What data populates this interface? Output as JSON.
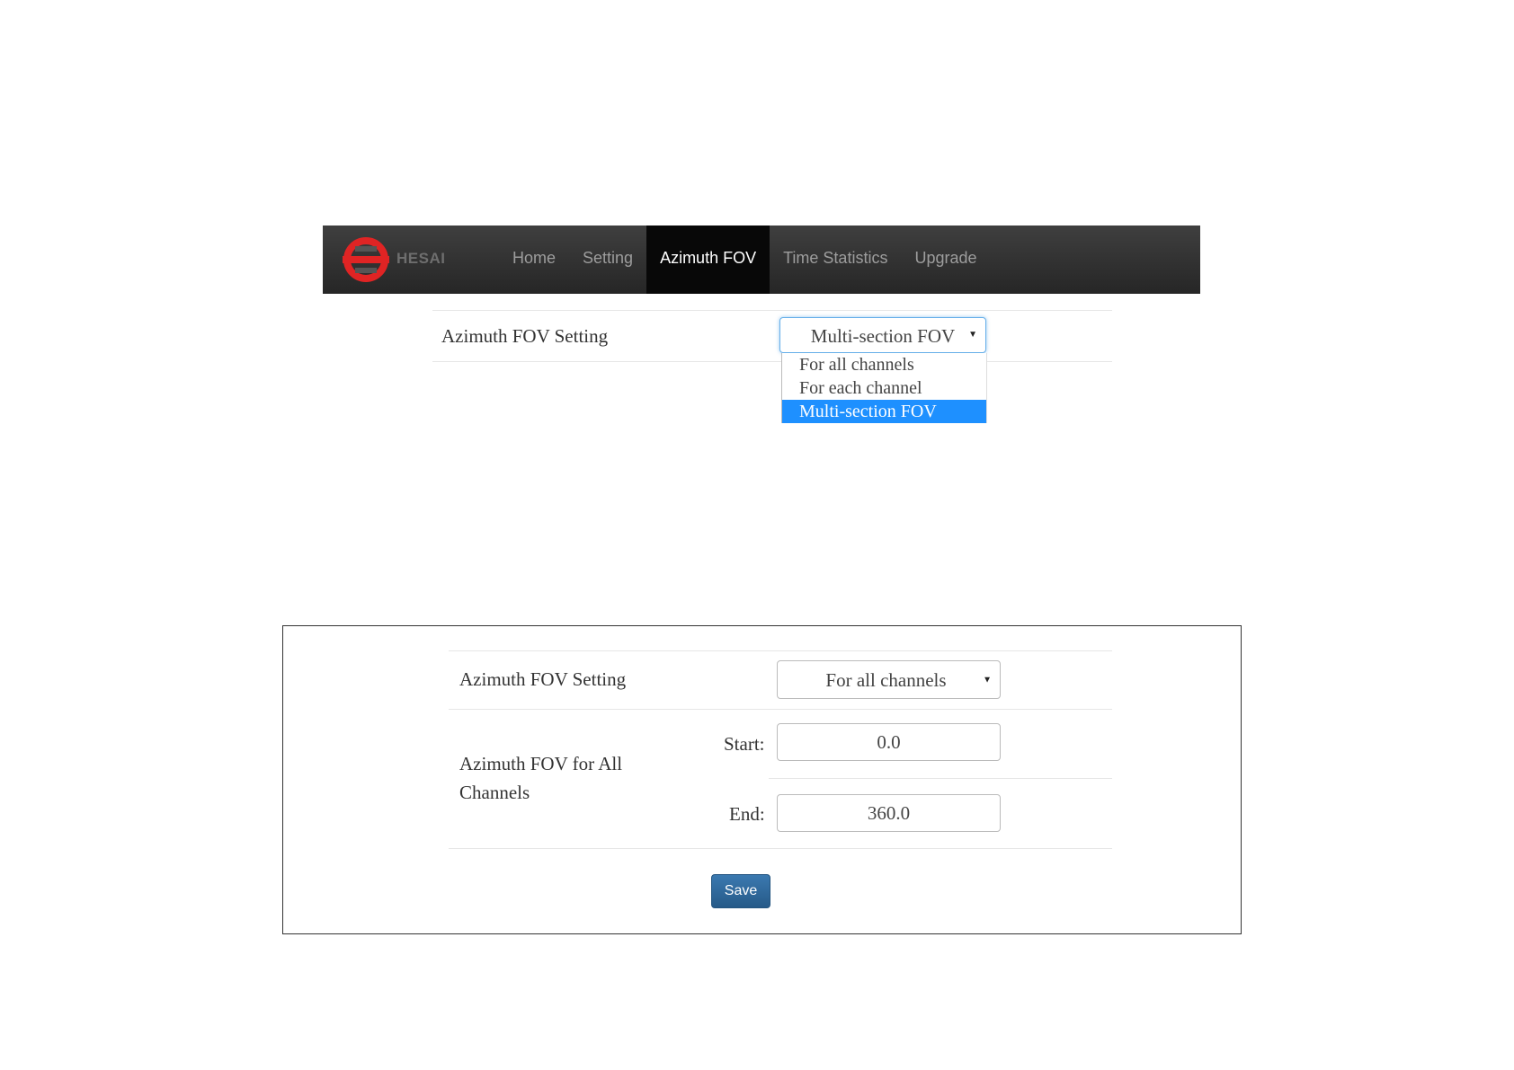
{
  "brand": {
    "name": "HESAI",
    "logo_color": "#e02424"
  },
  "navbar": {
    "items": [
      {
        "label": "Home"
      },
      {
        "label": "Setting"
      },
      {
        "label": "Azimuth FOV",
        "active": true
      },
      {
        "label": "Time Statistics"
      },
      {
        "label": "Upgrade"
      }
    ]
  },
  "top_form": {
    "setting_label": "Azimuth FOV Setting",
    "select_value": "Multi-section FOV",
    "dropdown_options": [
      "For all channels",
      "For each channel",
      "Multi-section FOV"
    ],
    "selected_option": "Multi-section FOV"
  },
  "bottom_form": {
    "setting_label": "Azimuth FOV Setting",
    "select_value": "For all channels",
    "fov_label": "Azimuth FOV for All Channels",
    "start_label": "Start:",
    "start_value": "0.0",
    "end_label": "End:",
    "end_value": "360.0",
    "save_label": "Save"
  },
  "colors": {
    "accent": "#1e90ff",
    "button": "#337ab7",
    "navbar": "#222222"
  },
  "icons": {
    "select_arrow": "▼"
  }
}
